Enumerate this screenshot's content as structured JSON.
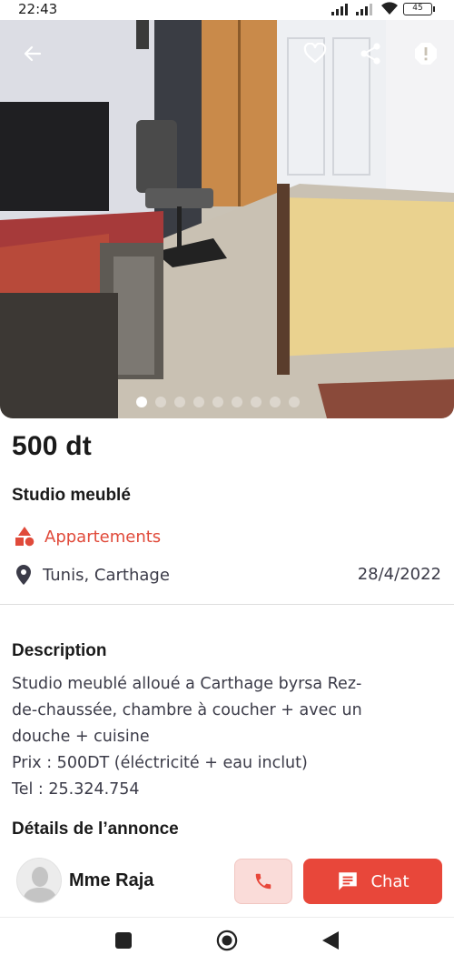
{
  "status_bar": {
    "time": "22:43",
    "battery": "45"
  },
  "listing": {
    "price": "500 dt",
    "title": "Studio meublé",
    "category": "Appartements",
    "location": "Tunis, Carthage",
    "date": "28/4/2022",
    "photo_count": 9,
    "active_photo": 1
  },
  "description": {
    "heading": "Description",
    "lines": [
      "Studio meublé  alloué a Carthage byrsa Rez-",
      "de-chaussée, chambre à coucher + avec un",
      "douche + cuisine",
      "Prix : 500DT (éléctricité + eau inclut)",
      "Tel : 25.324.754"
    ]
  },
  "details": {
    "heading": "Détails de l’annonce"
  },
  "seller": {
    "name": "Mme Raja"
  },
  "actions": {
    "chat_label": "Chat"
  },
  "colors": {
    "accent": "#e8473a",
    "accent_light": "#fadcd9",
    "text_dark": "#1a1a1a",
    "text_muted": "#3b3b48"
  },
  "icons": {
    "back": "arrow-left-icon",
    "favorite": "heart-icon",
    "share": "share-icon",
    "report": "alert-icon",
    "category": "shapes-icon",
    "location": "map-pin-icon",
    "call": "phone-icon",
    "chat": "message-icon"
  }
}
